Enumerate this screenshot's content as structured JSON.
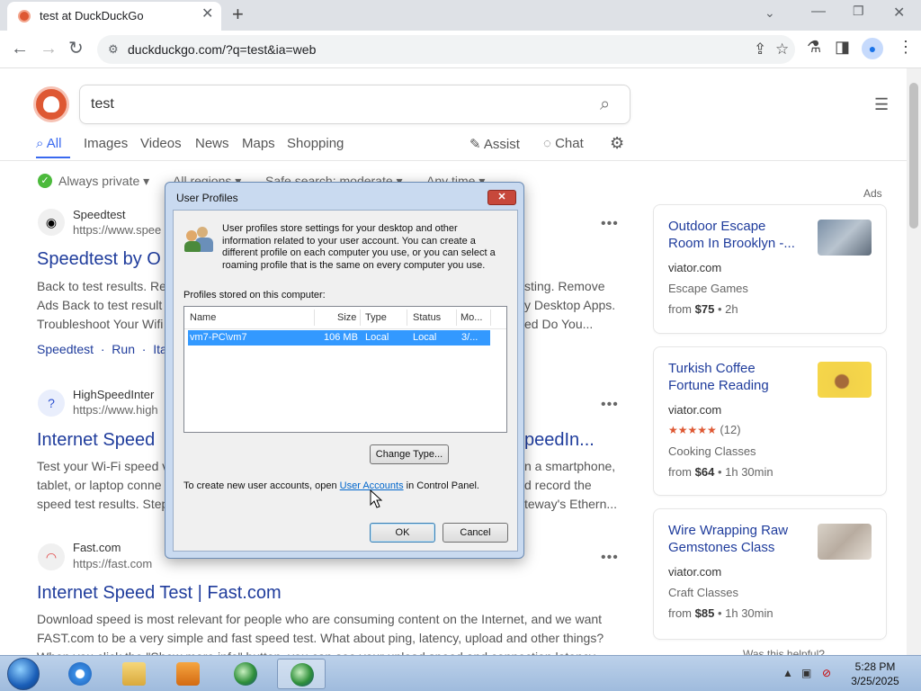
{
  "browser": {
    "tab_title": "test at DuckDuckGo",
    "new_tab": "+",
    "url": "duckduckgo.com/?q=test&ia=web"
  },
  "search": {
    "query": "test",
    "tabs": [
      {
        "label": "All"
      },
      {
        "label": "Images"
      },
      {
        "label": "Videos"
      },
      {
        "label": "News"
      },
      {
        "label": "Maps"
      },
      {
        "label": "Shopping"
      }
    ],
    "assist_label": "Assist",
    "chat_label": "Chat",
    "filters": {
      "always_private": "Always private",
      "region": "All regions",
      "safe_search": "Safe search: moderate",
      "time": "Any time"
    }
  },
  "results": [
    {
      "site_name": "Speedtest",
      "site_url": "https://www.spee",
      "title_left": "Speedtest by O",
      "snippet_line1_left": "Back to test results. Re",
      "snippet_line1_right": "sting. Remove",
      "snippet_line2_left": "Ads Back to test result",
      "snippet_line2_right": "y Desktop Apps.",
      "snippet_line3_left": "Troubleshoot Your Wifi",
      "snippet_line3_right": "ed Do You...",
      "links": [
        "Speedtest",
        "Run",
        "Ita"
      ]
    },
    {
      "site_name": "HighSpeedInter",
      "site_url": "https://www.high",
      "title_left": "Internet Speed",
      "title_right": "peedIn...",
      "snippet_line1_left": "Test your Wi-Fi speed v",
      "snippet_line1_right": "n a smartphone,",
      "snippet_line2_left": "tablet, or laptop conne",
      "snippet_line2_right": "d record the",
      "snippet_line3_left": "speed test results. Step",
      "snippet_line3_right": "teway's Ethern..."
    },
    {
      "site_name": "Fast.com",
      "site_url": "https://fast.com",
      "title": "Internet Speed Test | Fast.com",
      "snippet_line1": "Download speed is most relevant for people who are consuming content on the Internet, and we want",
      "snippet_line2": "FAST.com to be a very simple and fast speed test. What about ping, latency, upload and other things?",
      "snippet_line3": "When you click the \"Show more info\" button, you can see your upload speed and connection latency"
    }
  ],
  "ads": {
    "label": "Ads",
    "items": [
      {
        "title": "Outdoor Escape Room In Brooklyn -...",
        "domain": "viator.com",
        "category": "Escape Games",
        "price_prefix": "from",
        "price": "$75",
        "price_suffix": "• 2h"
      },
      {
        "title": "Turkish Coffee Fortune Reading",
        "domain": "viator.com",
        "rating_count": "(12)",
        "category": "Cooking Classes",
        "price_prefix": "from",
        "price": "$64",
        "price_suffix": "• 1h 30min"
      },
      {
        "title": "Wire Wrapping Raw Gemstones Class",
        "domain": "viator.com",
        "category": "Craft Classes",
        "price_prefix": "from",
        "price": "$85",
        "price_suffix": "• 1h 30min"
      }
    ],
    "helpful": "Was this helpful?"
  },
  "dialog": {
    "title": "User Profiles",
    "description": "User profiles store settings for your desktop and other information related to your user account. You can create a different profile on each computer you use, or you can select a roaming profile that is the same on every computer you use.",
    "profiles_label": "Profiles stored on this computer:",
    "columns": [
      "Name",
      "Size",
      "Type",
      "Status",
      "Mo..."
    ],
    "rows": [
      {
        "name": "vm7-PC\\vm7",
        "size": "106 MB",
        "type": "Local",
        "status": "Local",
        "modified": "3/..."
      }
    ],
    "change_type": "Change Type...",
    "ctl_prefix": "To create new user accounts, open ",
    "ctl_link": "User Accounts",
    "ctl_suffix": " in Control Panel.",
    "ok": "OK",
    "cancel": "Cancel"
  },
  "taskbar": {
    "time": "5:28 PM",
    "date": "3/25/2025"
  }
}
